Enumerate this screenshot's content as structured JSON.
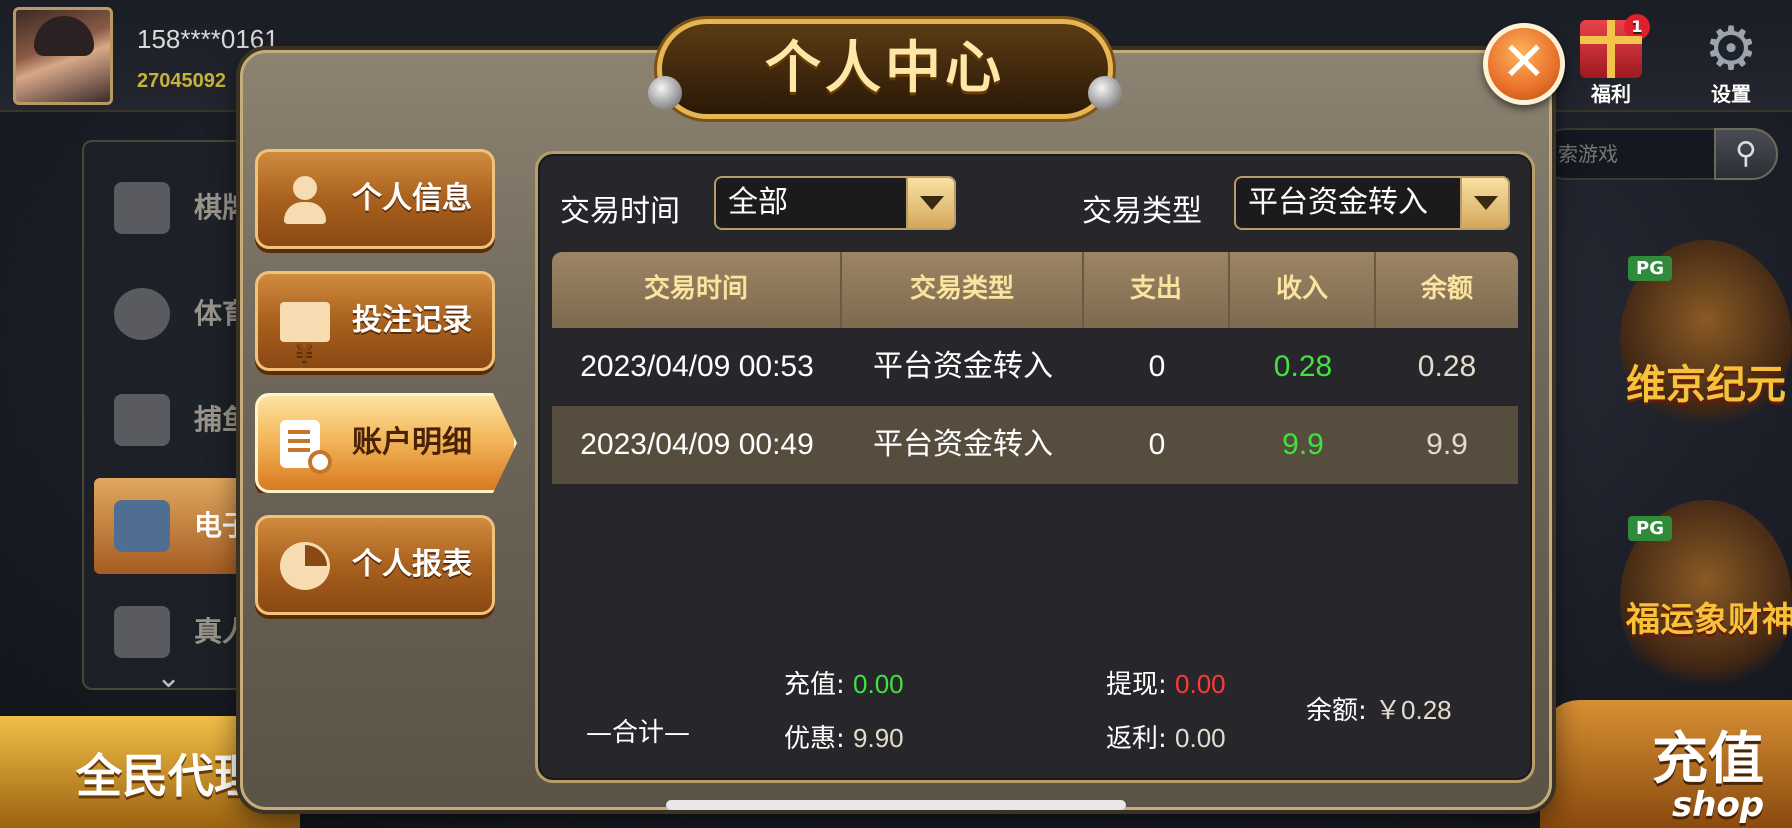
{
  "lobby": {
    "phone": "158****0161",
    "player_id": "27045092",
    "welfare_label": "福利",
    "welfare_badge": "1",
    "settings_label": "设置",
    "search_placeholder": "索游戏",
    "menu": [
      {
        "label": "棋牌",
        "active": false
      },
      {
        "label": "体育",
        "active": false
      },
      {
        "label": "捕鱼",
        "active": false
      },
      {
        "label": "电子",
        "active": true
      },
      {
        "label": "真人",
        "active": false
      }
    ],
    "promo_left": "全民代理",
    "promo_right": "充值",
    "promo_right_sub": "shop",
    "games": [
      {
        "provider": "PG",
        "name": "维京纪元"
      },
      {
        "provider": "PG",
        "name": "福运象财神"
      }
    ]
  },
  "modal": {
    "title": "个人中心",
    "close_icon": "close-icon",
    "tabs": [
      {
        "label": "个人信息",
        "icon": "person-icon",
        "active": false
      },
      {
        "label": "投注记录",
        "icon": "money-icon",
        "active": false
      },
      {
        "label": "账户明细",
        "icon": "document-search-icon",
        "active": true
      },
      {
        "label": "个人报表",
        "icon": "pie-chart-icon",
        "active": false
      }
    ],
    "filters": {
      "time_label": "交易时间",
      "time_value": "全部",
      "type_label": "交易类型",
      "type_value": "平台资金转入"
    },
    "table": {
      "columns": [
        "交易时间",
        "交易类型",
        "支出",
        "收入",
        "余额"
      ],
      "rows": [
        {
          "time": "2023/04/09 00:53",
          "type": "平台资金转入",
          "expense": "0",
          "income": "0.28",
          "balance": "0.28"
        },
        {
          "time": "2023/04/09 00:49",
          "type": "平台资金转入",
          "expense": "0",
          "income": "9.9",
          "balance": "9.9"
        }
      ]
    },
    "summary": {
      "total_label": "—合计—",
      "recharge_label": "充值:",
      "recharge_value": "0.00",
      "bonus_label": "优惠:",
      "bonus_value": "9.90",
      "withdraw_label": "提现:",
      "withdraw_value": "0.00",
      "rebate_label": "返利:",
      "rebate_value": "0.00",
      "balance_label": "余额:",
      "balance_value": "￥0.28"
    }
  },
  "colors": {
    "income_green": "#3fe33f",
    "withdraw_red": "#ff3838",
    "gold_text": "#fbe4a0"
  }
}
